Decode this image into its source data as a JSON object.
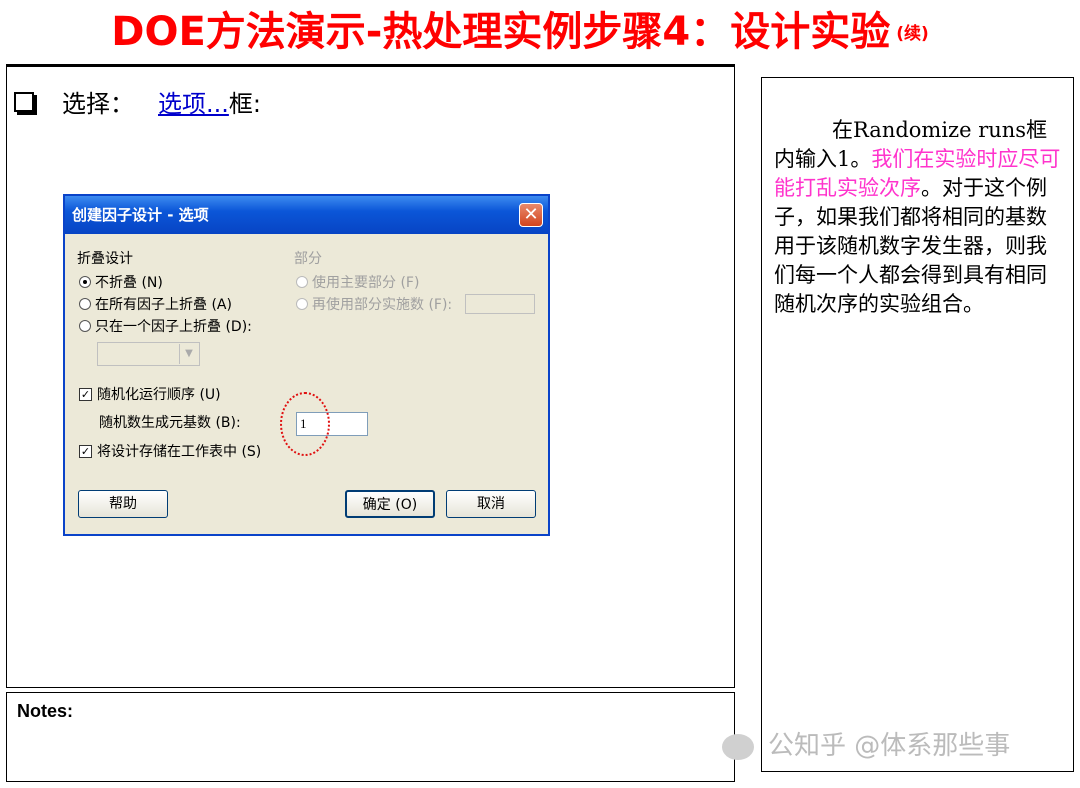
{
  "slide": {
    "title": "DOE方法演示-热处理实例步骤4：设计实验",
    "title_suffix": "(续)",
    "bullet_text": "选择：",
    "link_text": "选项...",
    "bullet_after": "框:",
    "notes_label": "Notes:",
    "side_text_a": "在Randomize runs框内输入1。",
    "side_text_pink": "我们在实验时应尽可能打乱实验次序",
    "side_text_b": "。对于这个例子，如果我们都将相同的基数用于该随机数字发生器，则我们每一个人都会得到具有相同随机次序的实验组合。",
    "watermark": "公知乎 @体系那些事"
  },
  "dialog": {
    "title": "创建因子设计 - 选项",
    "close_symbol": "✕",
    "fold_group_label": "折叠设计",
    "fold_options": [
      "不折叠 (N)",
      "在所有因子上折叠 (A)",
      "只在一个因子上折叠 (D):"
    ],
    "fold_selected": 0,
    "part_group_label": "部分",
    "part_options": [
      "使用主要部分 (F)",
      "再使用部分实施数 (F):"
    ],
    "randomize_label": "随机化运行顺序 (U)",
    "randomize_checked": true,
    "seed_label": "随机数生成元基数 (B):",
    "seed_value": "1",
    "store_label": "将设计存储在工作表中 (S)",
    "store_checked": true,
    "help_button": "帮助",
    "ok_button": "确定 (O)",
    "cancel_button": "取消",
    "check_mark": "✓"
  },
  "colors": {
    "title": "#ff0000",
    "link": "#0000cc",
    "highlight": "#ff33cc",
    "dialog_title_bar": "#0b56d8",
    "seed_marker": "#e01010"
  }
}
